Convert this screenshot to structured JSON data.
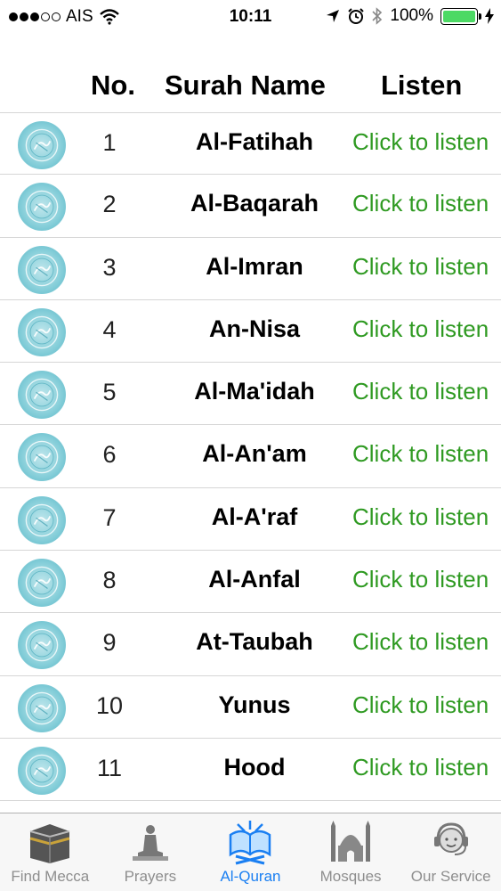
{
  "status_bar": {
    "carrier": "AIS",
    "time": "10:11",
    "battery_percent": "100%",
    "battery_level": 1.0,
    "signal_bars_filled": 3,
    "signal_bars_total": 5
  },
  "header": {
    "no_label": "No.",
    "name_label": "Surah Name",
    "listen_label": "Listen"
  },
  "surahs": [
    {
      "no": "1",
      "name": "Al-Fatihah",
      "listen": "Click to listen"
    },
    {
      "no": "2",
      "name": "Al-Baqarah",
      "listen": "Click to listen"
    },
    {
      "no": "3",
      "name": "Al-Imran",
      "listen": "Click to listen"
    },
    {
      "no": "4",
      "name": "An-Nisa",
      "listen": "Click to listen"
    },
    {
      "no": "5",
      "name": "Al-Ma'idah",
      "listen": "Click to listen"
    },
    {
      "no": "6",
      "name": "Al-An'am",
      "listen": "Click to listen"
    },
    {
      "no": "7",
      "name": "Al-A'raf",
      "listen": "Click to listen"
    },
    {
      "no": "8",
      "name": "Al-Anfal",
      "listen": "Click to listen"
    },
    {
      "no": "9",
      "name": "At-Taubah",
      "listen": "Click to listen"
    },
    {
      "no": "10",
      "name": "Yunus",
      "listen": "Click to listen"
    },
    {
      "no": "11",
      "name": "Hood",
      "listen": "Click to listen"
    }
  ],
  "tabs": [
    {
      "label": "Find Mecca",
      "icon": "kaaba-icon",
      "active": false
    },
    {
      "label": "Prayers",
      "icon": "praying-person-icon",
      "active": false
    },
    {
      "label": "Al-Quran",
      "icon": "quran-book-icon",
      "active": true
    },
    {
      "label": "Mosques",
      "icon": "mosque-icon",
      "active": false
    },
    {
      "label": "Our Service",
      "icon": "headset-agent-icon",
      "active": false
    }
  ],
  "colors": {
    "listen_green": "#2f9a22",
    "active_tab_blue": "#1a7ff2",
    "inactive_tab_gray": "#8e8e8e",
    "battery_green": "#4cd964",
    "quran_icon_teal": "#8ed2dc"
  }
}
